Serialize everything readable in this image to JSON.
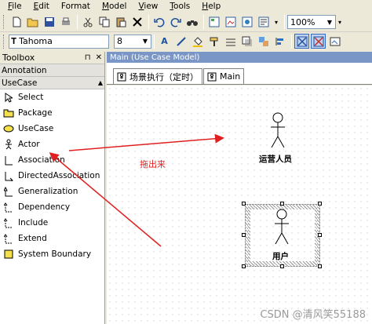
{
  "menu": [
    "File",
    "Edit",
    "Format",
    "Model",
    "View",
    "Tools",
    "Help"
  ],
  "menu_underline": [
    "F",
    "E",
    "",
    "M",
    "V",
    "T",
    "H"
  ],
  "toolbar": {
    "zoom": "100%",
    "font_name": "Tahoma",
    "font_size": "8"
  },
  "toolbox": {
    "title": "Toolbox",
    "pin": "⊓",
    "close": "✕",
    "groups": [
      "Annotation",
      "UseCase"
    ],
    "items": [
      {
        "label": "Select",
        "icon": "arrow-cursor-icon"
      },
      {
        "label": "Package",
        "icon": "package-icon"
      },
      {
        "label": "UseCase",
        "icon": "usecase-ellipse-icon"
      },
      {
        "label": "Actor",
        "icon": "actor-icon"
      },
      {
        "label": "Association",
        "icon": "association-icon"
      },
      {
        "label": "DirectedAssociation",
        "icon": "directed-association-icon"
      },
      {
        "label": "Generalization",
        "icon": "generalization-icon"
      },
      {
        "label": "Dependency",
        "icon": "dependency-icon"
      },
      {
        "label": "Include",
        "icon": "include-icon"
      },
      {
        "label": "Extend",
        "icon": "extend-icon"
      },
      {
        "label": "System Boundary",
        "icon": "system-boundary-icon"
      }
    ]
  },
  "document": {
    "title": "Main (Use Case Model)",
    "tabs": [
      "场景执行（定时）",
      "Main"
    ]
  },
  "diagram": {
    "actors": [
      "运营人员",
      "用户"
    ],
    "annotation": "拖出来"
  },
  "colors": {
    "arrow": "#e02020",
    "title_bar": "#7a96c6"
  },
  "watermark": "CSDN @清风笑55188"
}
